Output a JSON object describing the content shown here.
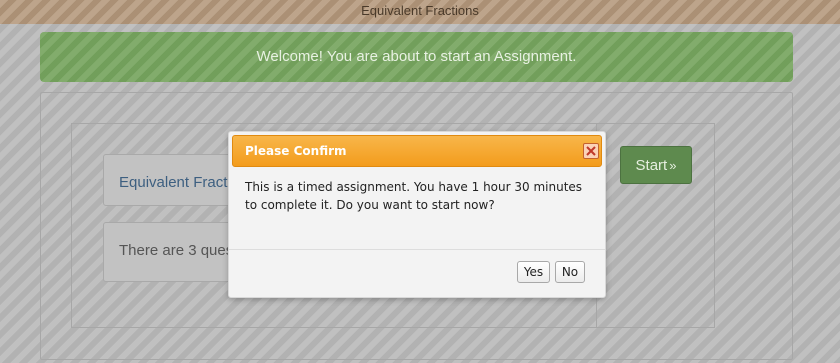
{
  "header": {
    "title": "Equivalent Fractions"
  },
  "welcome": {
    "message": "Welcome! You are about to start an Assignment."
  },
  "assignment": {
    "title": "Equivalent Fractions",
    "info": "There are 3 questions"
  },
  "start_button": {
    "label": "Start",
    "suffix": "»"
  },
  "dialog": {
    "title": "Please Confirm",
    "message": "This is a timed assignment. You have 1 hour 30 minutes to complete it. Do you want to start now?",
    "yes_label": "Yes",
    "no_label": "No",
    "close_icon": "close-icon"
  },
  "colors": {
    "header_bg": "#b4987b",
    "welcome_bg": "#77a55f",
    "start_btn_bg": "#5e8a4e",
    "dialog_header": "#f39c1c"
  }
}
